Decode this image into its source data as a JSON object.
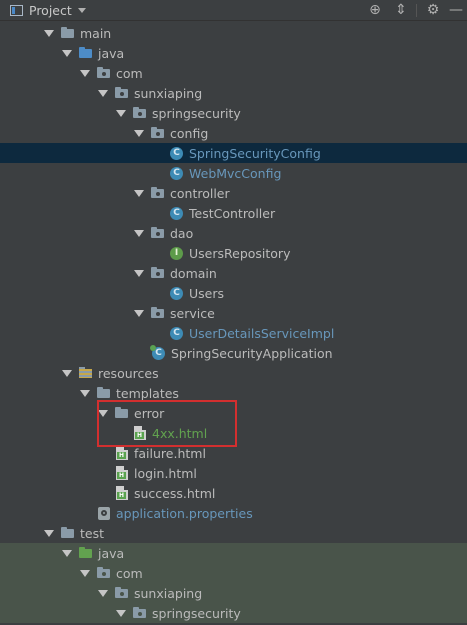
{
  "header": {
    "title": "Project",
    "icons": [
      "project-icon",
      "locate-icon",
      "collapse-all-icon",
      "gear-icon",
      "hide-icon"
    ]
  },
  "tree": {
    "main": "main",
    "java": "java",
    "com": "com",
    "sunxiaping": "sunxiaping",
    "springsecurity": "springsecurity",
    "config": "config",
    "SpringSecurityConfig": "SpringSecurityConfig",
    "WebMvcConfig": "WebMvcConfig",
    "controller": "controller",
    "TestController": "TestController",
    "dao": "dao",
    "UsersRepository": "UsersRepository",
    "domain": "domain",
    "Users": "Users",
    "service": "service",
    "UserDetailsServiceImpl": "UserDetailsServiceImpl",
    "SpringSecurityApplication": "SpringSecurityApplication",
    "resources": "resources",
    "templates": "templates",
    "error": "error",
    "4xx": "4xx.html",
    "failure": "failure.html",
    "login": "login.html",
    "success": "success.html",
    "application_properties": "application.properties",
    "test": "test",
    "test_java": "java",
    "test_com": "com",
    "test_sunxiaping": "sunxiaping",
    "test_springsecurity": "springsecurity"
  },
  "badges": {
    "class": "C",
    "interface": "I",
    "html": "H"
  },
  "colors": {
    "selection": "#0d293e",
    "highlight_box": "#d32f2f",
    "test_background": "#49544a",
    "link_blue": "#6897bb",
    "new_file_green": "#62a24f"
  }
}
